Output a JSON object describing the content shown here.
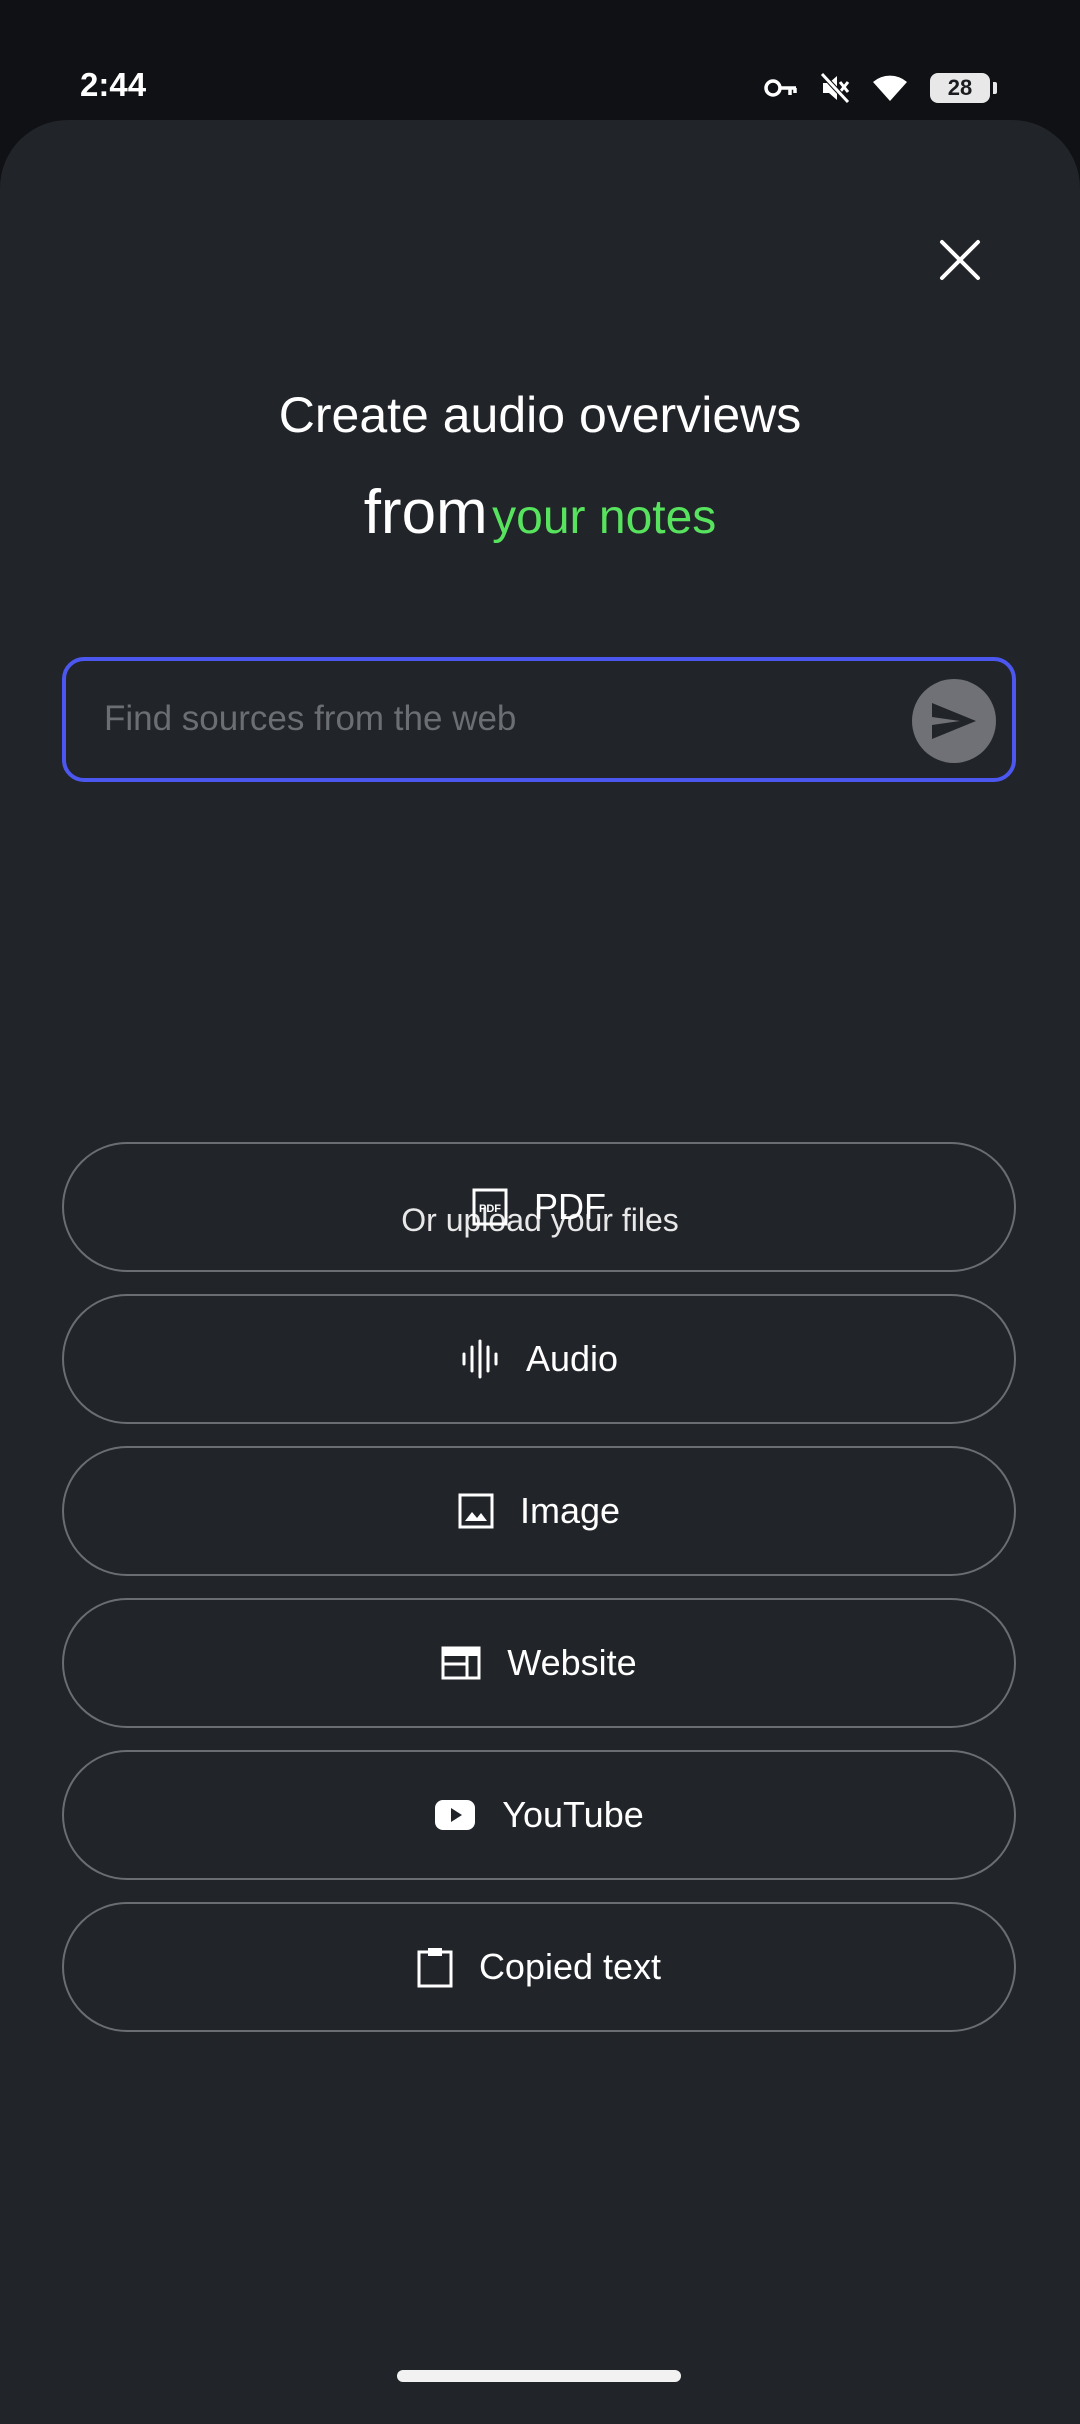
{
  "status_bar": {
    "time": "2:44",
    "battery_level": "28",
    "icons": [
      "vpn-key-icon",
      "mute-icon",
      "wifi-icon",
      "battery-icon"
    ]
  },
  "header": {
    "line1": "Create audio overviews",
    "line2_prefix": "from",
    "line2_accent": "your notes",
    "accent_color": "#58e35e"
  },
  "search": {
    "placeholder": "Find sources from the web",
    "value": "",
    "border_color": "#4c57ef"
  },
  "upload": {
    "label": "Or upload your files",
    "options": [
      {
        "label": "PDF",
        "icon": "pdf-icon"
      },
      {
        "label": "Audio",
        "icon": "audio-waveform-icon"
      },
      {
        "label": "Image",
        "icon": "image-icon"
      },
      {
        "label": "Website",
        "icon": "website-icon"
      },
      {
        "label": "YouTube",
        "icon": "youtube-icon"
      },
      {
        "label": "Copied text",
        "icon": "clipboard-icon"
      }
    ]
  }
}
